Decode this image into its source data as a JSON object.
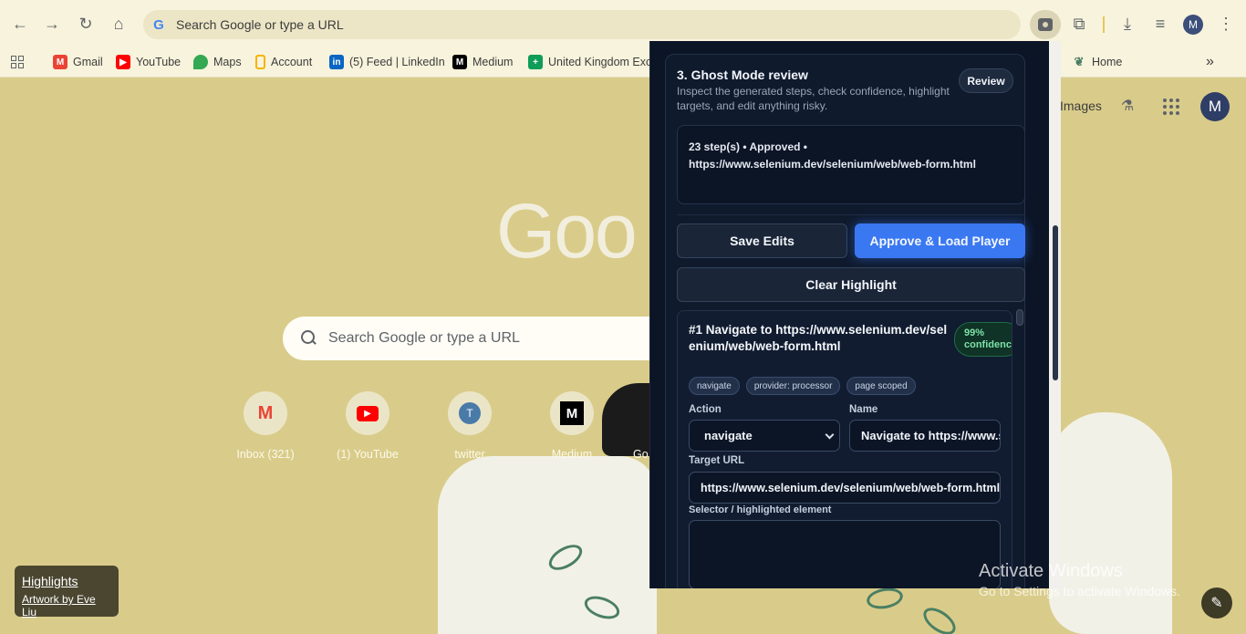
{
  "browser": {
    "omnibox_text": "Search Google or type a URL",
    "profile_initial": "M",
    "bookmarks": [
      {
        "label": "Gmail",
        "icon": "gmail-icon",
        "color": "#ea4335"
      },
      {
        "label": "YouTube",
        "icon": "youtube-icon",
        "color": "#ff0000"
      },
      {
        "label": "Maps",
        "icon": "maps-icon",
        "color": "#34a853"
      },
      {
        "label": "Account",
        "icon": "account-icon",
        "color": "#f4b400"
      },
      {
        "label": "(5) Feed | LinkedIn",
        "icon": "linkedin-icon",
        "color": "#0a66c2"
      },
      {
        "label": "Medium",
        "icon": "medium-icon",
        "color": "#000000"
      },
      {
        "label": "United Kingdom Exc...",
        "icon": "sheets-icon",
        "color": "#0f9d58"
      },
      {
        "label": "Home",
        "icon": "leaf-icon",
        "color": "#4a7f63"
      }
    ]
  },
  "ntp": {
    "images_link": "Images",
    "logo_text": "Goo",
    "search_placeholder": "Search Google or type a URL",
    "profile_initial": "M",
    "shortcuts": [
      {
        "label": "Inbox (321)",
        "icon": "gmail-icon",
        "glyph": "M"
      },
      {
        "label": "(1) YouTube",
        "icon": "youtube-icon",
        "glyph": "▶"
      },
      {
        "label": "twitter",
        "icon": "twitter-icon",
        "glyph": "T"
      },
      {
        "label": "Medium",
        "icon": "medium-icon",
        "glyph": "M"
      },
      {
        "label": "Go",
        "icon": "google-icon",
        "glyph": ""
      }
    ],
    "highlights_title": "Highlights",
    "highlights_credit": "Artwork by Eve Liu",
    "activate_title": "Activate Windows",
    "activate_sub": "Go to Settings to activate Windows."
  },
  "panel": {
    "section_title": "3. Ghost Mode review",
    "section_desc": "Inspect the generated steps, check confidence, highlight targets, and edit anything risky.",
    "review_label": "Review",
    "summary_line1": "23 step(s) • Approved •",
    "summary_line2": "https://www.selenium.dev/selenium/web/web-form.html",
    "save_label": "Save Edits",
    "approve_label": "Approve & Load Player",
    "clear_label": "Clear Highlight",
    "step": {
      "title": "#1 Navigate to https://www.selenium.dev/selenium/web/web-form.html",
      "confidence_value": "99%",
      "confidence_label": "confidence",
      "chips": [
        "navigate",
        "provider: processor",
        "page scoped"
      ],
      "action_label": "Action",
      "action_value": "navigate",
      "name_label": "Name",
      "name_value": "Navigate to https://www.selenium.dev/selenium/web/web-form.html",
      "target_label": "Target URL",
      "target_value": "https://www.selenium.dev/selenium/web/web-form.html",
      "selector_label": "Selector / highlighted element",
      "selector_value": ""
    }
  }
}
